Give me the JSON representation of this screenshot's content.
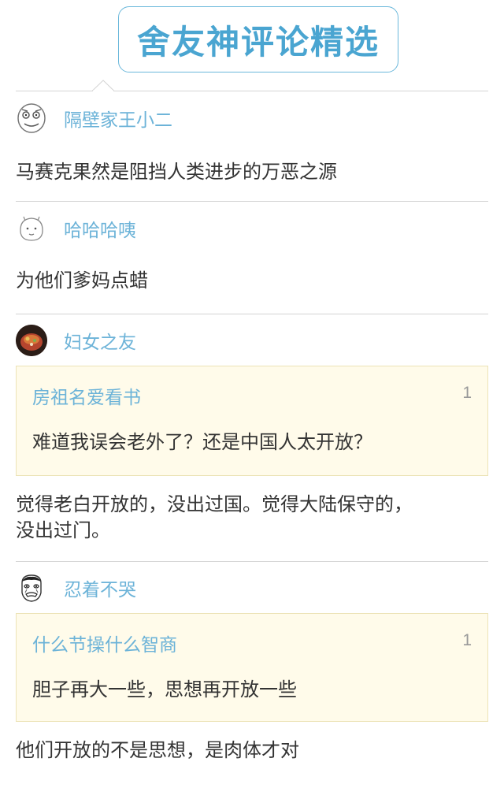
{
  "header": {
    "title": "舍友神评论精选"
  },
  "comments": [
    {
      "username": "隔壁家王小二",
      "avatar_icon": "rage-face-icon",
      "text": "马赛克果然是阻挡人类进步的万恶之源"
    },
    {
      "username": "哈哈哈咦",
      "avatar_icon": "cartoon-doodle-icon",
      "text": "为他们爹妈点蜡"
    },
    {
      "username": "妇女之友",
      "avatar_icon": "photo-avatar-icon",
      "quote": {
        "username": "房祖名爱看书",
        "number": "1",
        "text": "难道我误会老外了？还是中国人太开放？"
      },
      "text_line1": "觉得老白开放的，没出过国。觉得大陆保守的，",
      "text_line2": "没出过门。"
    },
    {
      "username": "忍着不哭",
      "avatar_icon": "meme-face-icon",
      "quote": {
        "username": "什么节操什么智商",
        "number": "1",
        "text": "胆子再大一些，思想再开放一些"
      },
      "text": "他们开放的不是思想，是肉体才对"
    }
  ],
  "colors": {
    "accent_blue": "#4aa5d1",
    "username_blue": "#6cb3d8",
    "quote_bg": "#fffbea",
    "quote_border": "#ece3b6",
    "divider": "#d4d4d4"
  }
}
